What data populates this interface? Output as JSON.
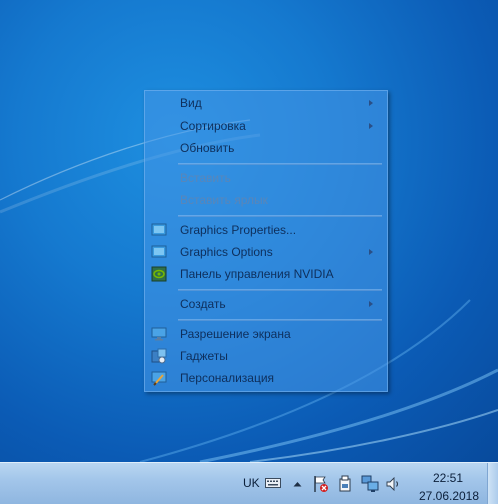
{
  "context_menu": {
    "items": [
      {
        "label": "Вид",
        "submenu": true
      },
      {
        "label": "Сортировка",
        "submenu": true
      },
      {
        "label": "Обновить"
      },
      {
        "label": "Вставить",
        "disabled": true
      },
      {
        "label": "Вставить ярлык",
        "disabled": true
      },
      {
        "label": "Graphics Properties...",
        "icon": "intel-graphics-icon"
      },
      {
        "label": "Graphics Options",
        "icon": "intel-graphics-icon",
        "submenu": true
      },
      {
        "label": "Панель управления NVIDIA",
        "icon": "nvidia-icon"
      },
      {
        "label": "Создать",
        "submenu": true
      },
      {
        "label": "Разрешение экрана",
        "icon": "screen-resolution-icon"
      },
      {
        "label": "Гаджеты",
        "icon": "gadgets-icon"
      },
      {
        "label": "Персонализация",
        "icon": "personalization-icon"
      }
    ]
  },
  "taskbar": {
    "language": "UK",
    "clock_time": "22:51",
    "clock_date": "27.06.2018"
  },
  "colors": {
    "desktop": "#1579cf",
    "menu_text": "#0e2f5c",
    "menu_disabled_text": "#5a86b8",
    "taskbar": "#a3c6ea"
  }
}
